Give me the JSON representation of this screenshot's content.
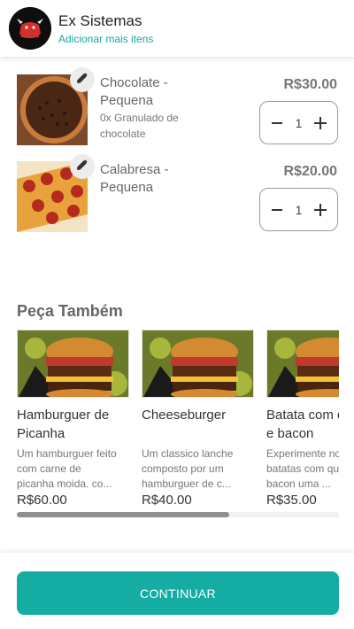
{
  "header": {
    "store_name": "Ex Sistemas",
    "add_more_link": "Adicionar mais itens"
  },
  "cart": {
    "items": [
      {
        "name": "Chocolate - Pequena",
        "extra": "0x Granulado de chocolate",
        "price": "R$30.00",
        "quantity": "1"
      },
      {
        "name": "Calabresa - Pequena",
        "extra": "",
        "price": "R$20.00",
        "quantity": "1"
      }
    ]
  },
  "suggestions": {
    "title": "Peça Também",
    "items": [
      {
        "name": "Hamburguer de Picanha",
        "description": "Um hamburguer feito com carne de picanha moida. co...",
        "price": "R$60.00"
      },
      {
        "name": "Cheeseburger",
        "description": "Um classico lanche composto por um hamburguer de c...",
        "price": "R$40.00"
      },
      {
        "name": "Batata com queijo e bacon",
        "description": "Experimente nossas batatas com queijo e bacon uma ...",
        "price": "R$35.00"
      }
    ],
    "scroll_fraction": 0.66
  },
  "footer": {
    "continue_label": "CONTINUAR"
  },
  "colors": {
    "accent": "#15ada3",
    "link": "#15a99c"
  },
  "icons": {
    "edit": "pencil-icon",
    "decrement": "minus-icon",
    "increment": "plus-icon",
    "logo": "bull-logo"
  }
}
